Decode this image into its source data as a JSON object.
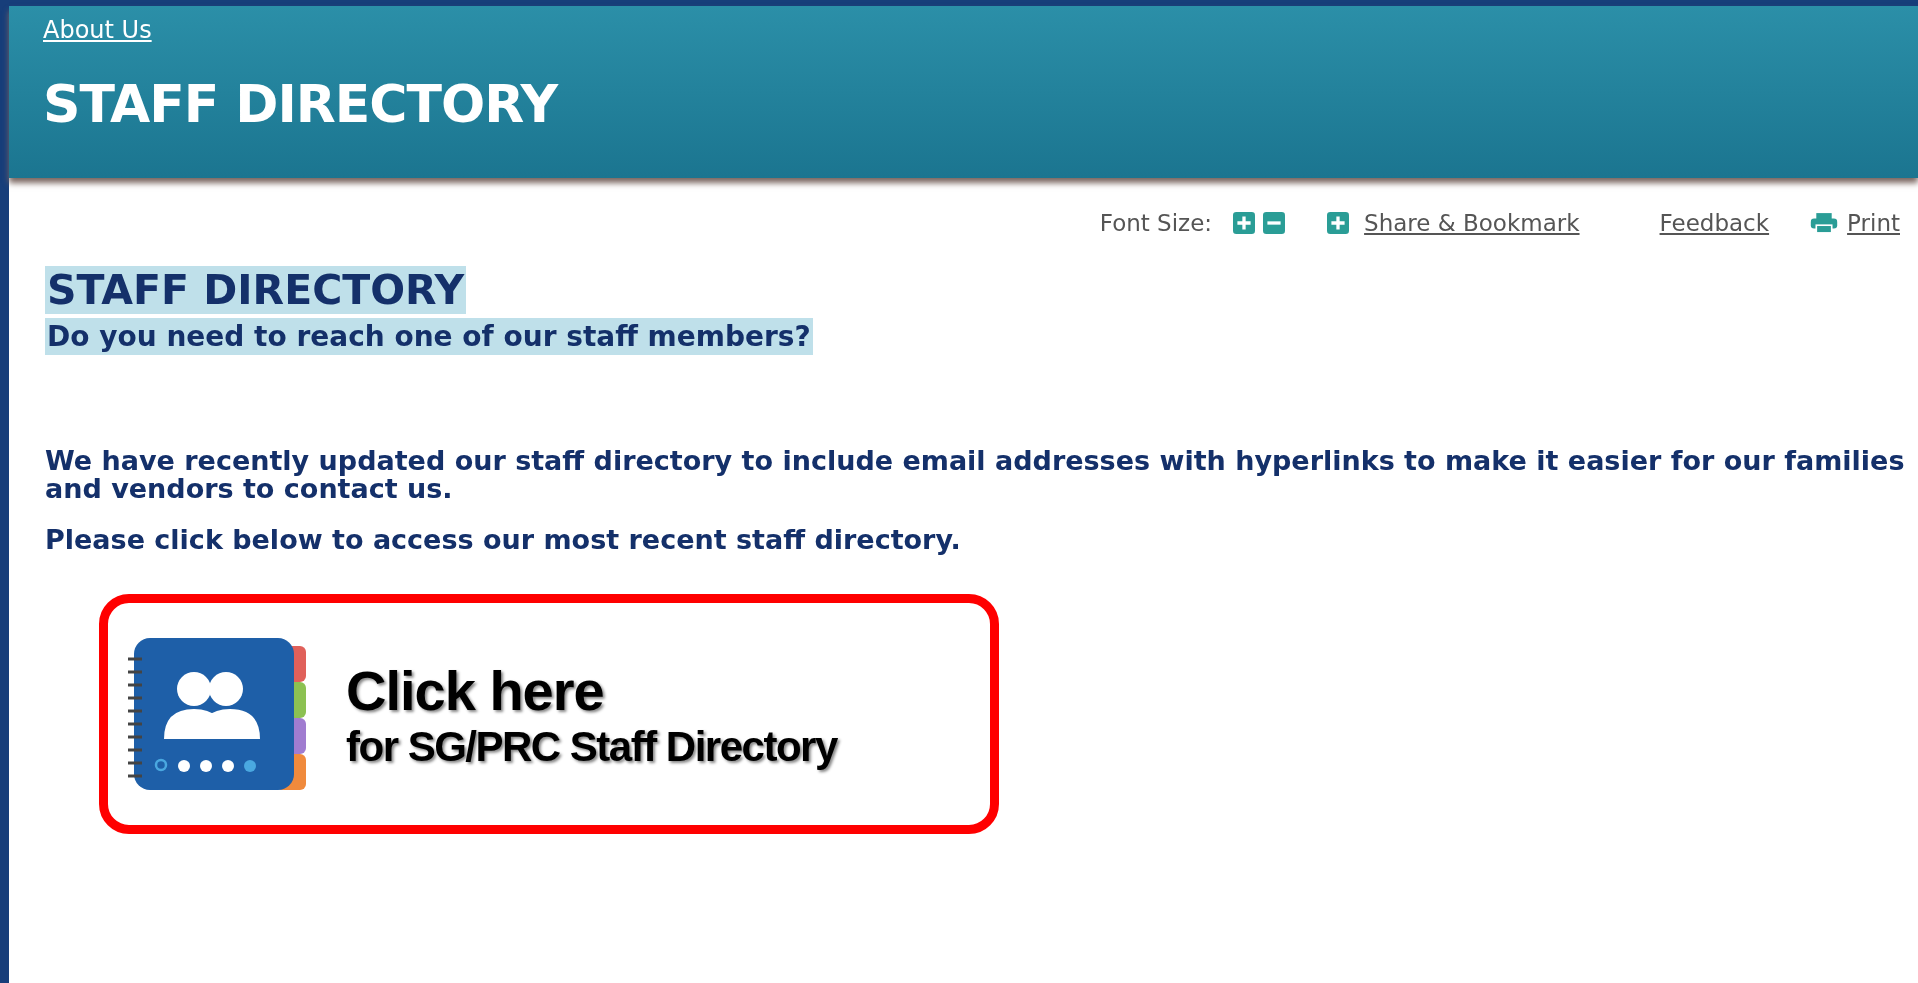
{
  "header": {
    "breadcrumb": "About Us",
    "title": "STAFF DIRECTORY"
  },
  "toolbar": {
    "font_size_label": "Font Size:",
    "share": "Share & Bookmark",
    "feedback": "Feedback",
    "print": "Print"
  },
  "content": {
    "heading": "STAFF DIRECTORY",
    "subheading": "Do you need to reach one of our staff members?",
    "paragraphs": [
      "We have recently updated our staff directory to include email addresses with hyperlinks to make it easier for our families and vendors to contact us.",
      "Please click below to access our most recent staff directory."
    ],
    "banner": {
      "line1": "Click here",
      "line2": "for SG/PRC Staff Directory"
    }
  }
}
